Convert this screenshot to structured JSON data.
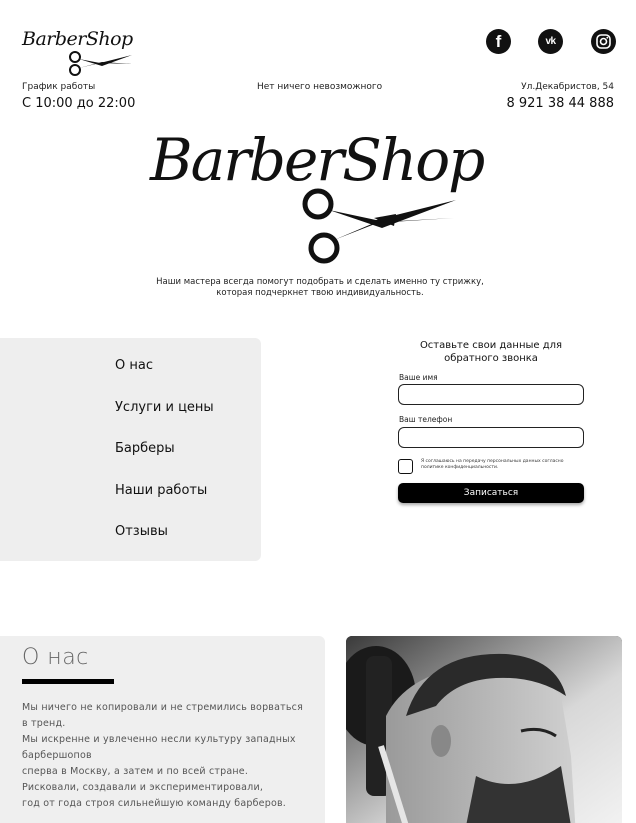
{
  "header": {
    "logo_text": "BarberShop",
    "schedule_label": "График работы",
    "schedule_hours": "С 10:00 до 22:00",
    "slogan": "Нет ничего невозможного",
    "address": "Ул.Декабристов, 54",
    "phone": "8 921 38 44 888",
    "social": [
      {
        "name": "facebook",
        "glyph": "f"
      },
      {
        "name": "vk",
        "glyph": "vk"
      },
      {
        "name": "instagram",
        "glyph": "ig"
      }
    ]
  },
  "hero": {
    "logo_text": "BarberShop",
    "tagline_line1": "Наши мастера всегда помогут подобрать и сделать именно ту стрижку,",
    "tagline_line2": "которая подчеркнет твою индивидуальность."
  },
  "nav": {
    "items": [
      "О нас",
      "Услуги и цены",
      "Барберы",
      "Наши работы",
      "Отзывы"
    ]
  },
  "form": {
    "title_line1": "Оставьте свои данные для",
    "title_line2": "обратного звонка",
    "name_label": "Ваше имя",
    "phone_label": "Ваш телефон",
    "name_value": "",
    "phone_value": "",
    "consent_line1": "Я соглашаюсь на передачу персональных данных согласно",
    "consent_line2": "политике конфиденциальности.",
    "submit_label": "Записаться"
  },
  "about": {
    "title": "О нас",
    "lines": [
      "Мы ничего не копировали и не стремились ворваться",
      "в тренд.",
      "Мы искренне и увлеченно несли культуру западных",
      "барбершопов",
      "сперва в Москву, а затем и по всей стране.",
      "Рисковали, создавали и экспериментировали,",
      "год от года строя сильнейшую команду барберов."
    ]
  },
  "colors": {
    "accent": "#000000",
    "panel": "#eeeeee",
    "text_muted": "#555555"
  }
}
